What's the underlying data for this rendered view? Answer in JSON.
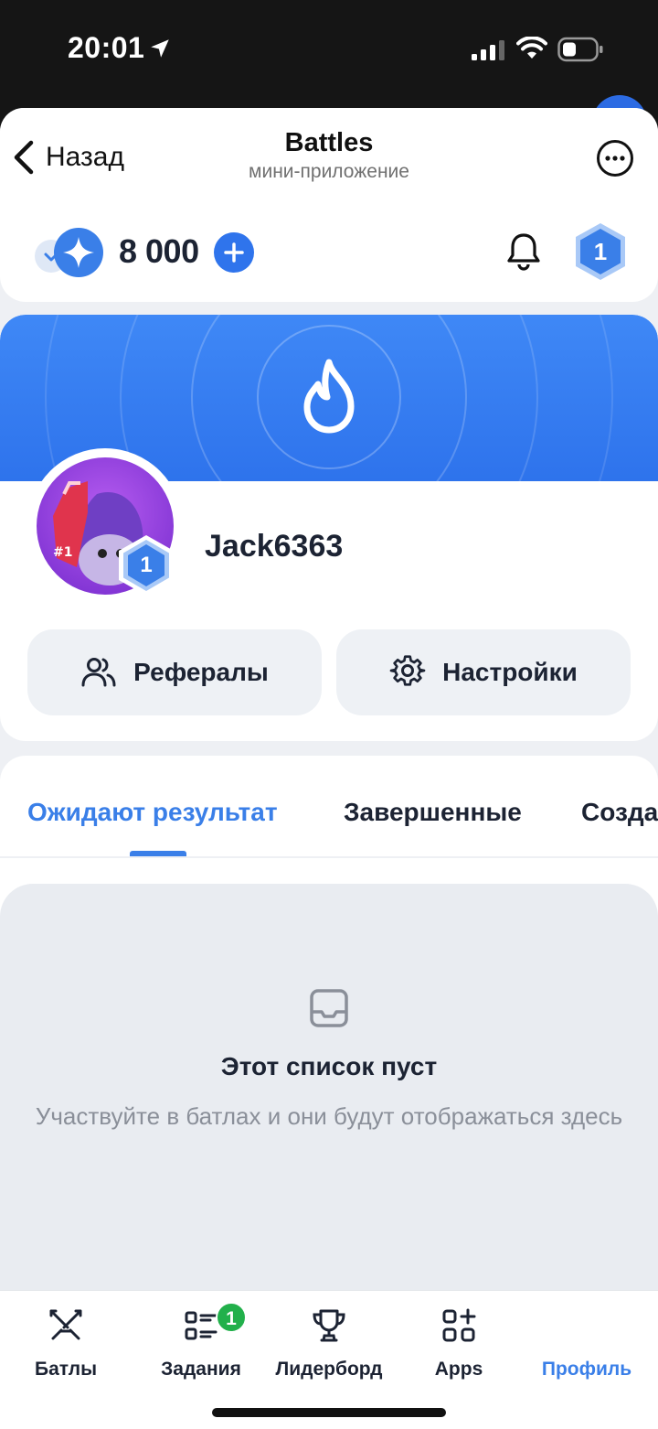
{
  "status_bar": {
    "time": "20:01",
    "icons": [
      "location-arrow-icon",
      "signal-icon",
      "wifi-icon",
      "battery-icon"
    ]
  },
  "navbar": {
    "back_label": "Назад",
    "title": "Battles",
    "subtitle": "мини-приложение",
    "more_icon": "more-dots-icon"
  },
  "topbar": {
    "balance": "8 000",
    "level": "1",
    "icons": [
      "star-coin-icon",
      "plus-icon",
      "bell-icon",
      "level-hexagon-icon"
    ]
  },
  "profile": {
    "username": "Jack6363",
    "level": "1",
    "buttons": {
      "referrals_label": "Рефералы",
      "settings_label": "Настройки"
    }
  },
  "tabs": [
    {
      "label": "Ожидают результат",
      "active": true
    },
    {
      "label": "Завершенные",
      "active": false
    },
    {
      "label": "Созда",
      "active": false
    }
  ],
  "empty_state": {
    "title": "Этот список пуст",
    "subtitle": "Участвуйте в батлах и они будут отображаться здесь"
  },
  "bottom_nav": {
    "items": [
      {
        "label": "Батлы",
        "icon": "swords-icon",
        "active": false
      },
      {
        "label": "Задания",
        "icon": "tasks-list-icon",
        "active": false,
        "badge": "1"
      },
      {
        "label": "Лидерборд",
        "icon": "trophy-icon",
        "active": false
      },
      {
        "label": "Apps",
        "icon": "apps-grid-icon",
        "active": false
      },
      {
        "label": "Профиль",
        "icon": "avatar-icon",
        "active": true
      }
    ]
  },
  "colors": {
    "accent": "#3a7fe8",
    "banner": "#2e73ec",
    "badge_green": "#22b04b",
    "background": "#eef0f4"
  }
}
